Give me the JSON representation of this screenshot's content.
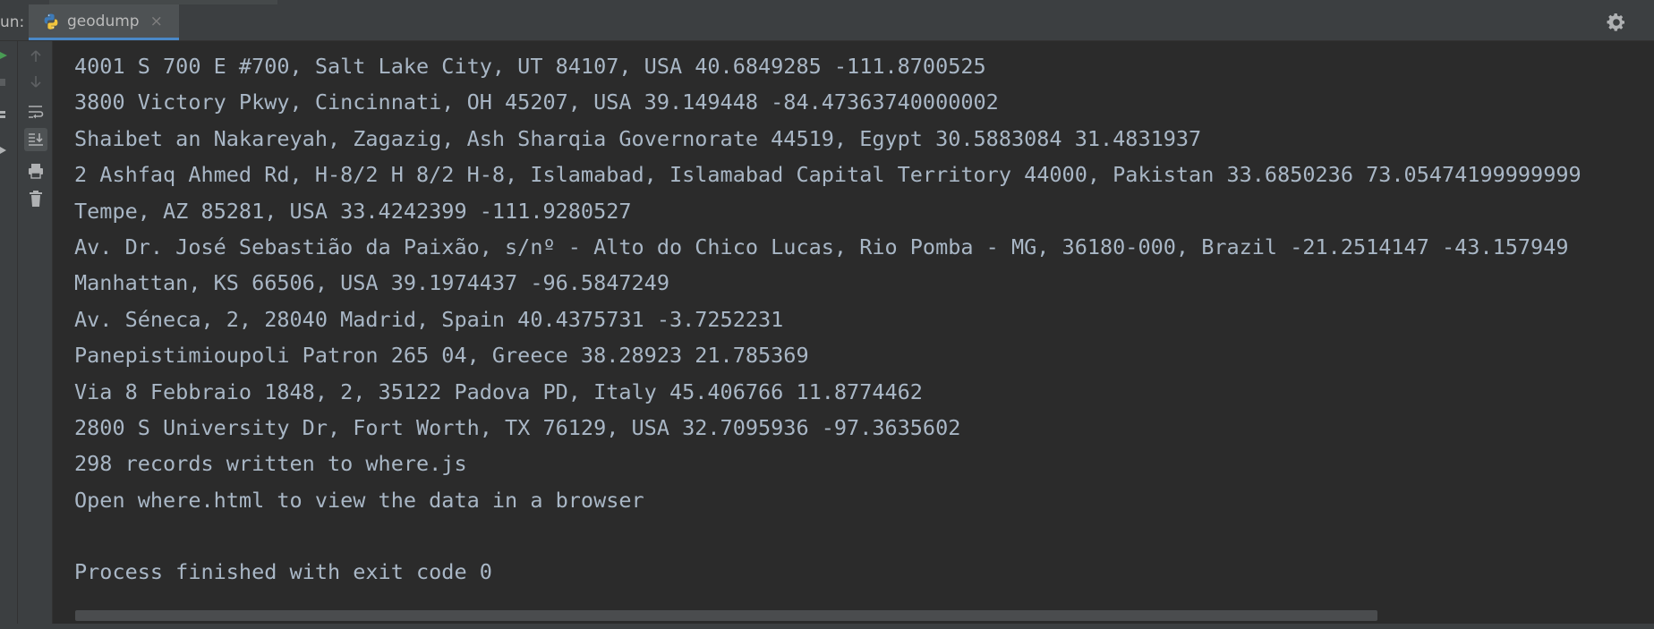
{
  "run_panel": {
    "label": "un:",
    "tab": {
      "title": "geodump",
      "icon": "python-icon",
      "close_glyph": "×"
    },
    "settings_icon": "gear-icon"
  },
  "toolbar": {
    "buttons": [
      {
        "name": "rerun-up-icon",
        "glyph": "↑"
      },
      {
        "name": "scroll-down-icon",
        "glyph": "↓"
      },
      {
        "name": "soft-wrap-icon",
        "glyph": "wrap"
      },
      {
        "name": "scroll-to-end-icon",
        "glyph": "end"
      },
      {
        "name": "print-icon",
        "glyph": "print"
      },
      {
        "name": "trash-icon",
        "glyph": "trash"
      }
    ]
  },
  "console": {
    "lines": [
      "4001 S 700 E #700, Salt Lake City, UT 84107, USA 40.6849285 -111.8700525",
      "3800 Victory Pkwy, Cincinnati, OH 45207, USA 39.149448 -84.47363740000002",
      "Shaibet an Nakareyah, Zagazig, Ash Sharqia Governorate 44519, Egypt 30.5883084 31.4831937",
      "2 Ashfaq Ahmed Rd, H-8/2 H 8/2 H-8, Islamabad, Islamabad Capital Territory 44000, Pakistan 33.6850236 73.05474199999999",
      "Tempe, AZ 85281, USA 33.4242399 -111.9280527",
      "Av. Dr. José Sebastião da Paixão, s/nº - Alto do Chico Lucas, Rio Pomba - MG, 36180-000, Brazil -21.2514147 -43.157949",
      "Manhattan, KS 66506, USA 39.1974437 -96.5847249",
      "Av. Séneca, 2, 28040 Madrid, Spain 40.4375731 -3.7252231",
      "Panepistimioupoli Patron 265 04, Greece 38.28923 21.785369",
      "Via 8 Febbraio 1848, 2, 35122 Padova PD, Italy 45.406766 11.8774462",
      "2800 S University Dr, Fort Worth, TX 76129, USA 32.7095936 -97.3635602",
      "298 records written to where.js",
      "Open where.html to view the data in a browser",
      "",
      "Process finished with exit code 0"
    ]
  },
  "colors": {
    "background": "#2b2b2b",
    "panel": "#3c3f41",
    "text": "#a9b7c6",
    "accent": "#4a88c7"
  }
}
